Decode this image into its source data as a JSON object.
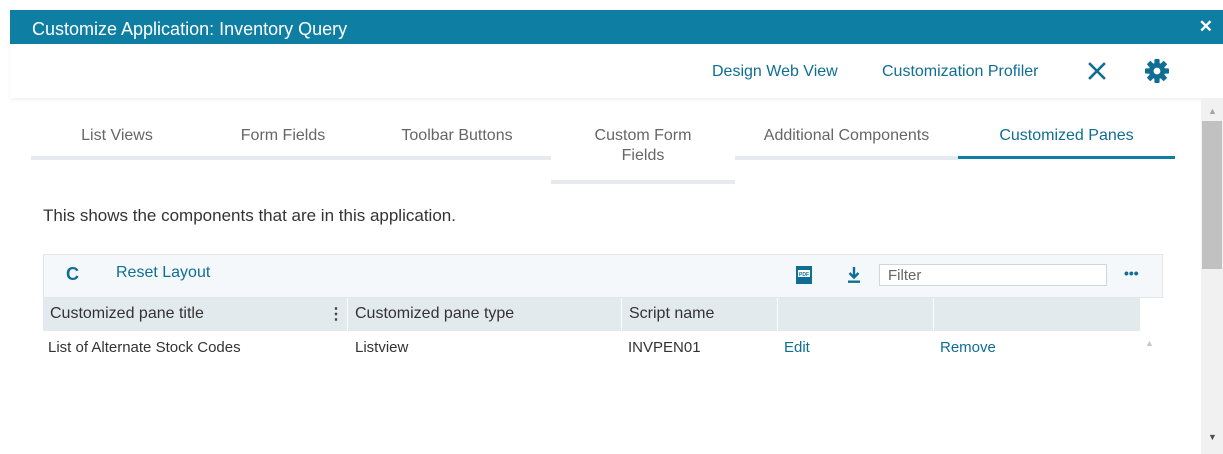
{
  "window": {
    "title": "Customize Application: Inventory Query",
    "close_symbol": "✕"
  },
  "toolbar": {
    "design_web_view": "Design Web View",
    "customization_profiler": "Customization Profiler",
    "close_icon": "close-icon",
    "settings_icon": "gear-icon"
  },
  "tabs": [
    {
      "label": "List Views",
      "active": false
    },
    {
      "label": "Form Fields",
      "active": false
    },
    {
      "label": "Toolbar Buttons",
      "active": false
    },
    {
      "label": "Custom Form Fields",
      "active": false
    },
    {
      "label": "Additional Components",
      "active": false
    },
    {
      "label": "Customized Panes",
      "active": true
    }
  ],
  "description": "This shows the components that are in this application.",
  "grid": {
    "refresh_symbol": "C",
    "reset_layout": "Reset Layout",
    "pdf_icon": "pdf-export-icon",
    "download_icon": "download-icon",
    "filter_placeholder": "Filter",
    "more_symbol": "•••",
    "columns": [
      "Customized pane title",
      "Customized pane type",
      "Script name",
      "",
      ""
    ],
    "column_menu_symbol": "⋮",
    "rows": [
      {
        "title": "List of Alternate Stock Codes",
        "type": "Listview",
        "script": "INVPEN01",
        "edit": "Edit",
        "remove": "Remove"
      }
    ]
  },
  "colors": {
    "titlebar": "#0f7ea3",
    "link": "#0f6e93",
    "header_bg": "#e3eaee"
  }
}
